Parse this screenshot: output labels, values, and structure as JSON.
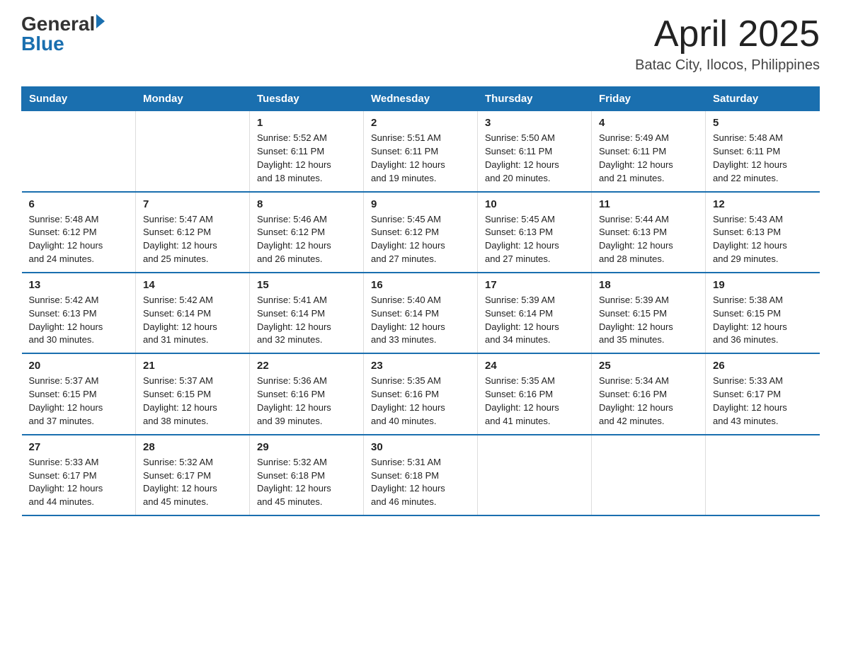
{
  "header": {
    "logo_general": "General",
    "logo_blue": "Blue",
    "title": "April 2025",
    "location": "Batac City, Ilocos, Philippines"
  },
  "days_of_week": [
    "Sunday",
    "Monday",
    "Tuesday",
    "Wednesday",
    "Thursday",
    "Friday",
    "Saturday"
  ],
  "weeks": [
    [
      {
        "day": "",
        "info": ""
      },
      {
        "day": "",
        "info": ""
      },
      {
        "day": "1",
        "info": "Sunrise: 5:52 AM\nSunset: 6:11 PM\nDaylight: 12 hours\nand 18 minutes."
      },
      {
        "day": "2",
        "info": "Sunrise: 5:51 AM\nSunset: 6:11 PM\nDaylight: 12 hours\nand 19 minutes."
      },
      {
        "day": "3",
        "info": "Sunrise: 5:50 AM\nSunset: 6:11 PM\nDaylight: 12 hours\nand 20 minutes."
      },
      {
        "day": "4",
        "info": "Sunrise: 5:49 AM\nSunset: 6:11 PM\nDaylight: 12 hours\nand 21 minutes."
      },
      {
        "day": "5",
        "info": "Sunrise: 5:48 AM\nSunset: 6:11 PM\nDaylight: 12 hours\nand 22 minutes."
      }
    ],
    [
      {
        "day": "6",
        "info": "Sunrise: 5:48 AM\nSunset: 6:12 PM\nDaylight: 12 hours\nand 24 minutes."
      },
      {
        "day": "7",
        "info": "Sunrise: 5:47 AM\nSunset: 6:12 PM\nDaylight: 12 hours\nand 25 minutes."
      },
      {
        "day": "8",
        "info": "Sunrise: 5:46 AM\nSunset: 6:12 PM\nDaylight: 12 hours\nand 26 minutes."
      },
      {
        "day": "9",
        "info": "Sunrise: 5:45 AM\nSunset: 6:12 PM\nDaylight: 12 hours\nand 27 minutes."
      },
      {
        "day": "10",
        "info": "Sunrise: 5:45 AM\nSunset: 6:13 PM\nDaylight: 12 hours\nand 27 minutes."
      },
      {
        "day": "11",
        "info": "Sunrise: 5:44 AM\nSunset: 6:13 PM\nDaylight: 12 hours\nand 28 minutes."
      },
      {
        "day": "12",
        "info": "Sunrise: 5:43 AM\nSunset: 6:13 PM\nDaylight: 12 hours\nand 29 minutes."
      }
    ],
    [
      {
        "day": "13",
        "info": "Sunrise: 5:42 AM\nSunset: 6:13 PM\nDaylight: 12 hours\nand 30 minutes."
      },
      {
        "day": "14",
        "info": "Sunrise: 5:42 AM\nSunset: 6:14 PM\nDaylight: 12 hours\nand 31 minutes."
      },
      {
        "day": "15",
        "info": "Sunrise: 5:41 AM\nSunset: 6:14 PM\nDaylight: 12 hours\nand 32 minutes."
      },
      {
        "day": "16",
        "info": "Sunrise: 5:40 AM\nSunset: 6:14 PM\nDaylight: 12 hours\nand 33 minutes."
      },
      {
        "day": "17",
        "info": "Sunrise: 5:39 AM\nSunset: 6:14 PM\nDaylight: 12 hours\nand 34 minutes."
      },
      {
        "day": "18",
        "info": "Sunrise: 5:39 AM\nSunset: 6:15 PM\nDaylight: 12 hours\nand 35 minutes."
      },
      {
        "day": "19",
        "info": "Sunrise: 5:38 AM\nSunset: 6:15 PM\nDaylight: 12 hours\nand 36 minutes."
      }
    ],
    [
      {
        "day": "20",
        "info": "Sunrise: 5:37 AM\nSunset: 6:15 PM\nDaylight: 12 hours\nand 37 minutes."
      },
      {
        "day": "21",
        "info": "Sunrise: 5:37 AM\nSunset: 6:15 PM\nDaylight: 12 hours\nand 38 minutes."
      },
      {
        "day": "22",
        "info": "Sunrise: 5:36 AM\nSunset: 6:16 PM\nDaylight: 12 hours\nand 39 minutes."
      },
      {
        "day": "23",
        "info": "Sunrise: 5:35 AM\nSunset: 6:16 PM\nDaylight: 12 hours\nand 40 minutes."
      },
      {
        "day": "24",
        "info": "Sunrise: 5:35 AM\nSunset: 6:16 PM\nDaylight: 12 hours\nand 41 minutes."
      },
      {
        "day": "25",
        "info": "Sunrise: 5:34 AM\nSunset: 6:16 PM\nDaylight: 12 hours\nand 42 minutes."
      },
      {
        "day": "26",
        "info": "Sunrise: 5:33 AM\nSunset: 6:17 PM\nDaylight: 12 hours\nand 43 minutes."
      }
    ],
    [
      {
        "day": "27",
        "info": "Sunrise: 5:33 AM\nSunset: 6:17 PM\nDaylight: 12 hours\nand 44 minutes."
      },
      {
        "day": "28",
        "info": "Sunrise: 5:32 AM\nSunset: 6:17 PM\nDaylight: 12 hours\nand 45 minutes."
      },
      {
        "day": "29",
        "info": "Sunrise: 5:32 AM\nSunset: 6:18 PM\nDaylight: 12 hours\nand 45 minutes."
      },
      {
        "day": "30",
        "info": "Sunrise: 5:31 AM\nSunset: 6:18 PM\nDaylight: 12 hours\nand 46 minutes."
      },
      {
        "day": "",
        "info": ""
      },
      {
        "day": "",
        "info": ""
      },
      {
        "day": "",
        "info": ""
      }
    ]
  ]
}
